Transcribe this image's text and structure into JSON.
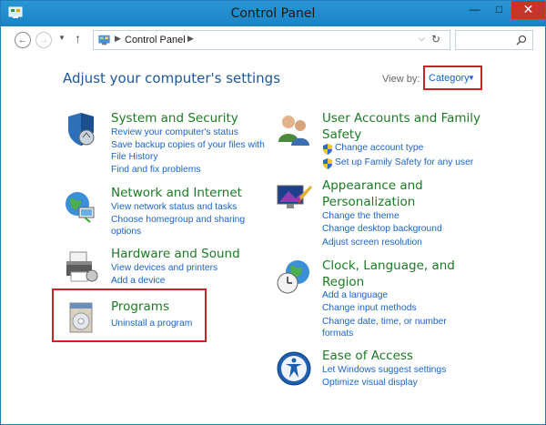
{
  "window": {
    "title": "Control Panel"
  },
  "address": {
    "location": "Control Panel"
  },
  "main": {
    "heading": "Adjust your computer's settings"
  },
  "view": {
    "label": "View by:",
    "value": "Category"
  },
  "categories": {
    "system": {
      "title": "System and Security",
      "links": [
        "Review your computer's status",
        "Save backup copies of your files with",
        "File History",
        "Find and fix problems"
      ]
    },
    "network": {
      "title": "Network and Internet",
      "links": [
        "View network status and tasks",
        "Choose homegroup and sharing",
        "options"
      ]
    },
    "hardware": {
      "title": "Hardware and Sound",
      "links": [
        "View devices and printers",
        "Add a device"
      ]
    },
    "programs": {
      "title": "Programs",
      "links": [
        "Uninstall a program"
      ]
    },
    "users": {
      "title_lines": [
        "User Accounts and Family",
        "Safety"
      ],
      "links": [
        "Change account type",
        "Set up Family Safety for any user"
      ]
    },
    "appearance": {
      "title_lines": [
        "Appearance and",
        "Personalization"
      ],
      "links": [
        "Change the theme",
        "Change desktop background",
        "Adjust screen resolution"
      ]
    },
    "clock": {
      "title_lines": [
        "Clock, Language, and",
        "Region"
      ],
      "links": [
        "Add a language",
        "Change input methods",
        "Change date, time, or number",
        "formats"
      ]
    },
    "ease": {
      "title": "Ease of Access",
      "links": [
        "Let Windows suggest settings",
        "Optimize visual display"
      ]
    }
  },
  "colors": {
    "titlebar": "#1f8ac9",
    "category_title": "#1c7a24",
    "link": "#1a64c8",
    "highlight": "#cc2129",
    "close": "#c7342a"
  },
  "icons": [
    "control-panel-icon",
    "back-arrow-icon",
    "forward-arrow-icon",
    "up-arrow-icon",
    "refresh-icon",
    "search-icon",
    "shield-icon"
  ]
}
